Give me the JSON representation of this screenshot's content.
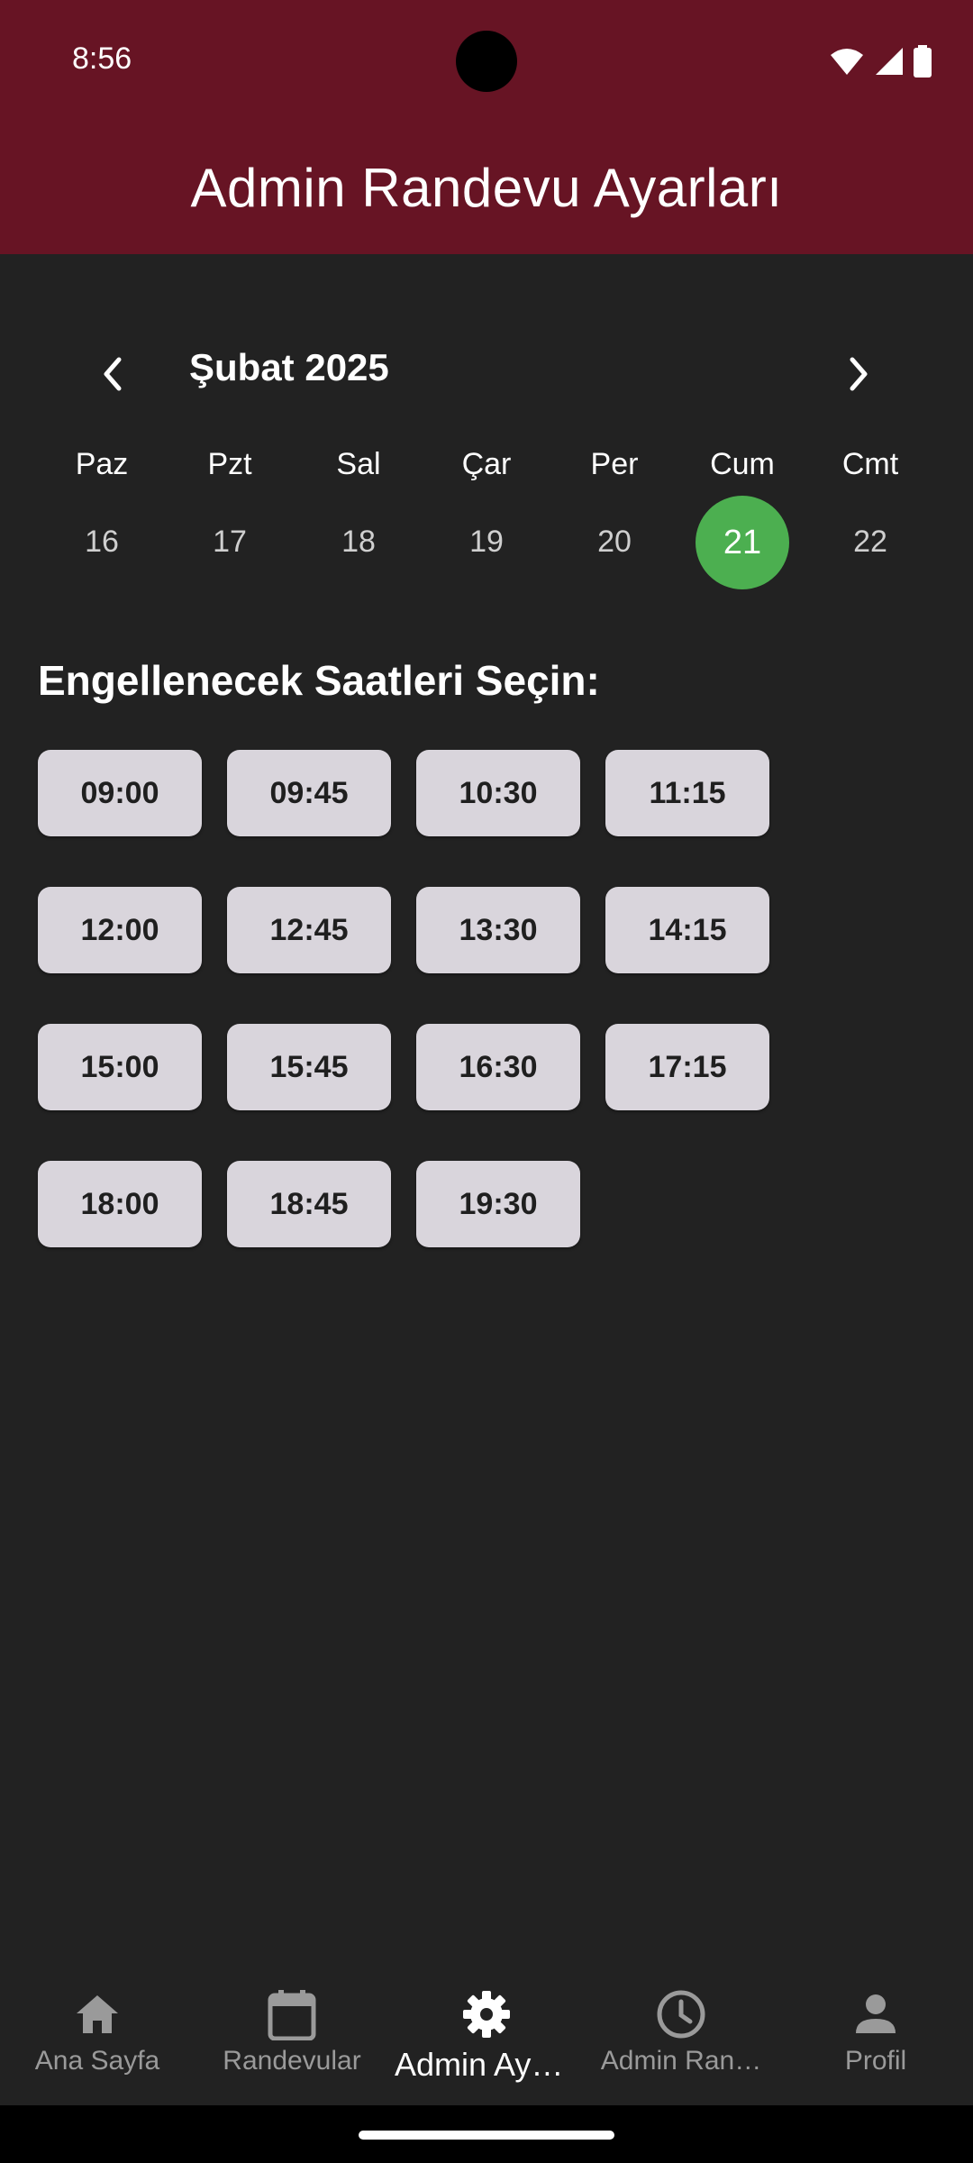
{
  "status_bar": {
    "time": "8:56"
  },
  "appbar": {
    "title": "Admin Randevu Ayarları"
  },
  "calendar": {
    "month_title": "Şubat 2025",
    "days": [
      {
        "name": "Paz",
        "num": "16"
      },
      {
        "name": "Pzt",
        "num": "17"
      },
      {
        "name": "Sal",
        "num": "18"
      },
      {
        "name": "Çar",
        "num": "19"
      },
      {
        "name": "Per",
        "num": "20"
      },
      {
        "name": "Cum",
        "num": "21",
        "selected": true
      },
      {
        "name": "Cmt",
        "num": "22"
      }
    ]
  },
  "slots_section": {
    "title": "Engellenecek Saatleri Seçin:",
    "slots": [
      "09:00",
      "09:45",
      "10:30",
      "11:15",
      "12:00",
      "12:45",
      "13:30",
      "14:15",
      "15:00",
      "15:45",
      "16:30",
      "17:15",
      "18:00",
      "18:45",
      "19:30"
    ]
  },
  "bottom_nav": {
    "items": [
      {
        "label": "Ana Sayfa",
        "icon": "home-icon"
      },
      {
        "label": "Randevular",
        "icon": "calendar-icon"
      },
      {
        "label": "Admin Aya…",
        "icon": "gear-icon",
        "active": true
      },
      {
        "label": "Admin Ran…",
        "icon": "clock-icon"
      },
      {
        "label": "Profil",
        "icon": "person-icon"
      }
    ]
  },
  "colors": {
    "appbar": "#671424",
    "background": "#222222",
    "selected_day": "#4caf50",
    "slot_bg": "#d9d5dc"
  }
}
